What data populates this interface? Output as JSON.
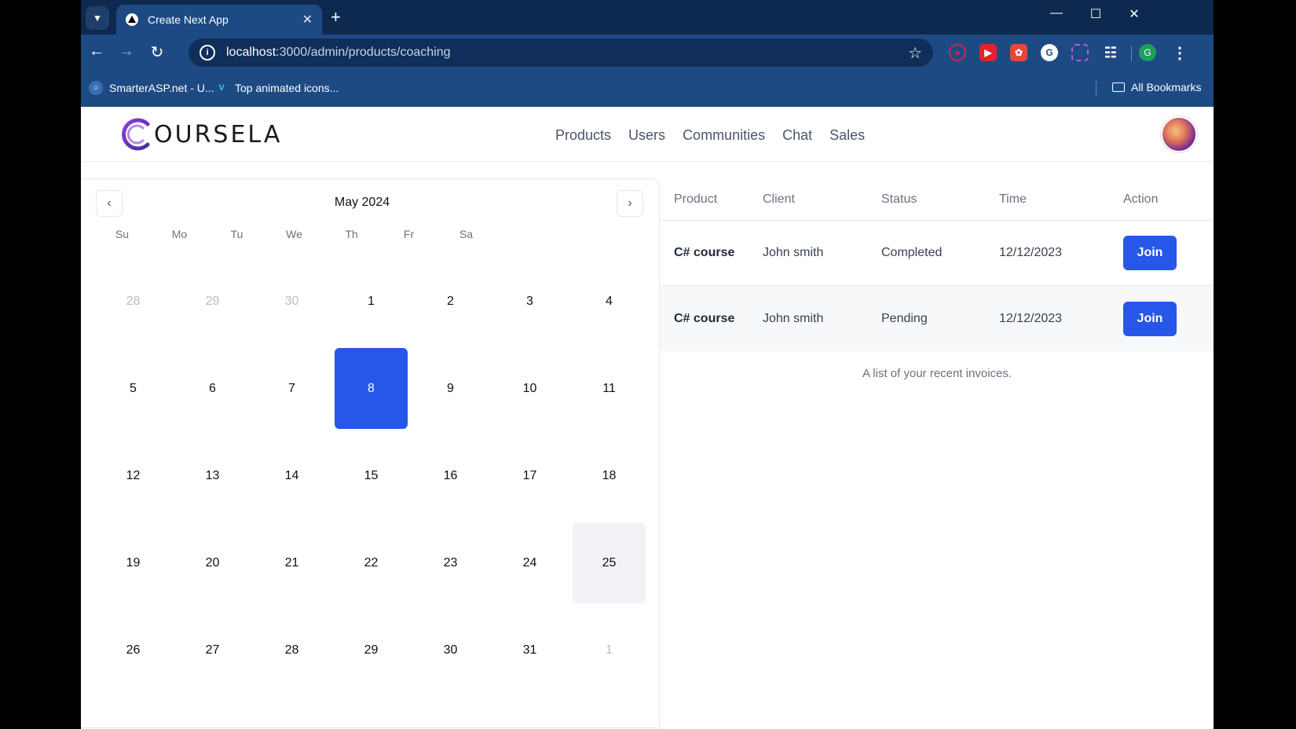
{
  "browser": {
    "tab_title": "Create Next App",
    "url_host": "localhost",
    "url_path": ":3000/admin/products/coaching",
    "bookmarks": [
      {
        "label": "SmarterASP.net - U..."
      },
      {
        "label": "Top animated icons..."
      }
    ],
    "all_bookmarks": "All Bookmarks",
    "profile_initial": "G"
  },
  "app": {
    "logo_text": "OURSELA",
    "nav": [
      "Products",
      "Users",
      "Communities",
      "Chat",
      "Sales"
    ]
  },
  "calendar": {
    "title": "May 2024",
    "weekdays": [
      "Su",
      "Mo",
      "Tu",
      "We",
      "Th",
      "Fr",
      "Sa"
    ],
    "selected_day": "8",
    "today_day": "25",
    "weeks": [
      [
        "28",
        "29",
        "30",
        "1",
        "2",
        "3",
        "4"
      ],
      [
        "5",
        "6",
        "7",
        "8",
        "9",
        "10",
        "11"
      ],
      [
        "12",
        "13",
        "14",
        "15",
        "16",
        "17",
        "18"
      ],
      [
        "19",
        "20",
        "21",
        "22",
        "23",
        "24",
        "25"
      ],
      [
        "26",
        "27",
        "28",
        "29",
        "30",
        "31",
        "1"
      ]
    ]
  },
  "table": {
    "headers": [
      "Product",
      "Client",
      "Status",
      "Time",
      "Action"
    ],
    "rows": [
      {
        "product": "C# course",
        "client": "John smith",
        "status": "Completed",
        "time": "12/12/2023",
        "action": "Join"
      },
      {
        "product": "C# course",
        "client": "John smith",
        "status": "Pending",
        "time": "12/12/2023",
        "action": "Join"
      }
    ],
    "caption": "A list of your recent invoices."
  }
}
